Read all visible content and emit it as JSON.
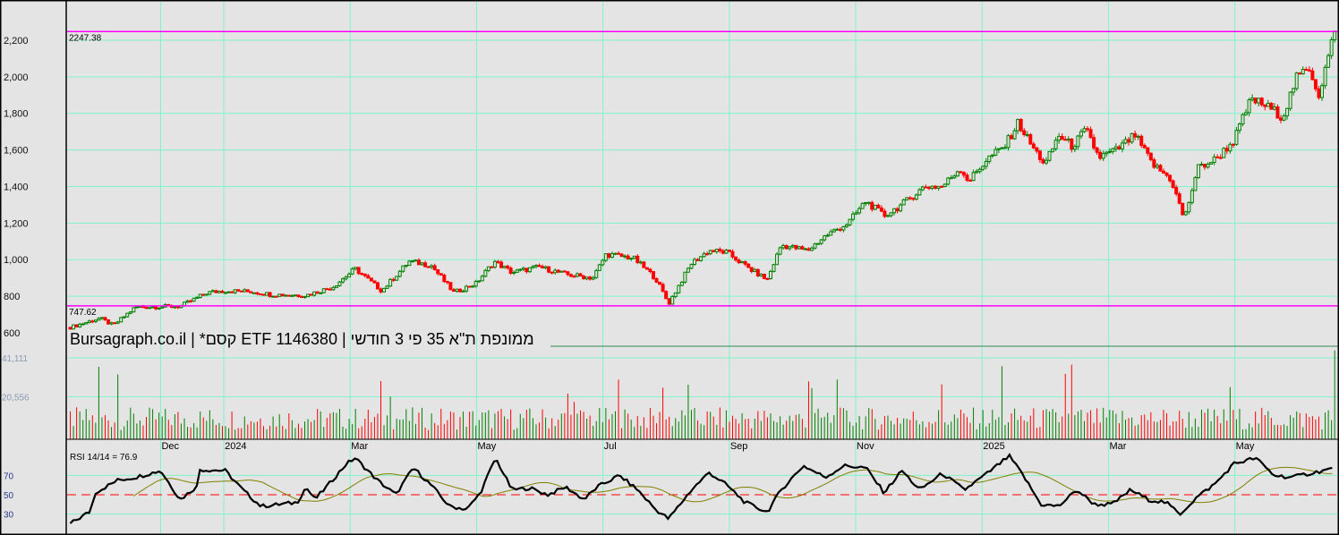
{
  "chart_data": {
    "type": "candlestick",
    "title": "Bursagraph.co.il | *קסם ETF 1146380 | ממונפת ת\"א 35 פי 3 חודשי",
    "x_unit": "months since 2023-10-01",
    "x_range": [
      0.52,
      20.62
    ],
    "month_ticks": [
      {
        "label": "Dec",
        "m": 2
      },
      {
        "label": "2024",
        "m": 3
      },
      {
        "label": "Mar",
        "m": 5
      },
      {
        "label": "May",
        "m": 7
      },
      {
        "label": "Jul",
        "m": 9
      },
      {
        "label": "Sep",
        "m": 11
      },
      {
        "label": "Nov",
        "m": 13
      },
      {
        "label": "2025",
        "m": 15
      },
      {
        "label": "Mar",
        "m": 17
      },
      {
        "label": "May",
        "m": 19
      }
    ],
    "price": {
      "ylim": [
        560,
        2290
      ],
      "ticks": [
        "600",
        "800",
        "1,000",
        "1,200",
        "1,400",
        "1,600",
        "1,800",
        "2,000",
        "2,200"
      ],
      "tick_values": [
        600,
        800,
        1000,
        1200,
        1400,
        1600,
        1800,
        2000,
        2200
      ],
      "high_line": {
        "value": 2247.38,
        "label": "2247.38",
        "color": "#ff00ff"
      },
      "low_line": {
        "value": 747.62,
        "label": "747.62",
        "color": "#ff00ff"
      },
      "close_anchors": [
        [
          0.57,
          630
        ],
        [
          1.04,
          680
        ],
        [
          1.25,
          640
        ],
        [
          1.6,
          740
        ],
        [
          2.31,
          745
        ],
        [
          2.74,
          820
        ],
        [
          3.02,
          830
        ],
        [
          3.45,
          825
        ],
        [
          3.73,
          810
        ],
        [
          4.3,
          805
        ],
        [
          4.72,
          850
        ],
        [
          5.08,
          950
        ],
        [
          5.5,
          830
        ],
        [
          5.93,
          990
        ],
        [
          6.28,
          970
        ],
        [
          6.64,
          820
        ],
        [
          6.99,
          870
        ],
        [
          7.28,
          990
        ],
        [
          7.56,
          930
        ],
        [
          7.99,
          960
        ],
        [
          8.41,
          920
        ],
        [
          8.84,
          900
        ],
        [
          9.05,
          1030
        ],
        [
          9.48,
          1010
        ],
        [
          9.83,
          900
        ],
        [
          10.04,
          760
        ],
        [
          10.4,
          980
        ],
        [
          10.68,
          1050
        ],
        [
          10.96,
          1040
        ],
        [
          11.32,
          950
        ],
        [
          11.6,
          890
        ],
        [
          11.82,
          1080
        ],
        [
          12.24,
          1050
        ],
        [
          12.52,
          1130
        ],
        [
          12.88,
          1200
        ],
        [
          13.16,
          1320
        ],
        [
          13.45,
          1240
        ],
        [
          13.73,
          1300
        ],
        [
          14.09,
          1400
        ],
        [
          14.37,
          1400
        ],
        [
          14.65,
          1500
        ],
        [
          14.79,
          1430
        ],
        [
          15.08,
          1550
        ],
        [
          15.36,
          1620
        ],
        [
          15.57,
          1750
        ],
        [
          15.79,
          1620
        ],
        [
          16.0,
          1520
        ],
        [
          16.21,
          1680
        ],
        [
          16.43,
          1620
        ],
        [
          16.64,
          1710
        ],
        [
          16.85,
          1560
        ],
        [
          17.13,
          1600
        ],
        [
          17.42,
          1680
        ],
        [
          17.7,
          1520
        ],
        [
          17.99,
          1440
        ],
        [
          18.2,
          1220
        ],
        [
          18.41,
          1500
        ],
        [
          18.7,
          1550
        ],
        [
          18.98,
          1650
        ],
        [
          19.26,
          1880
        ],
        [
          19.55,
          1830
        ],
        [
          19.76,
          1780
        ],
        [
          19.97,
          1990
        ],
        [
          20.18,
          2050
        ],
        [
          20.33,
          1900
        ],
        [
          20.47,
          2100
        ],
        [
          20.58,
          2250
        ]
      ],
      "up_color": "#008000",
      "down_color": "#ff0000"
    },
    "volume": {
      "ticks": [
        "41,111",
        "20,556"
      ],
      "tick_values": [
        41111,
        20556
      ]
    },
    "rsi": {
      "label": "RSI 14/14 = 76.9",
      "ticks": [
        "70",
        "50",
        "30"
      ],
      "tick_values": [
        70,
        50,
        30
      ],
      "anchors": [
        [
          0.57,
          20
        ],
        [
          0.89,
          33
        ],
        [
          0.96,
          52
        ],
        [
          1.32,
          65
        ],
        [
          1.6,
          68
        ],
        [
          2.0,
          75
        ],
        [
          2.31,
          45
        ],
        [
          2.6,
          60
        ],
        [
          2.62,
          76
        ],
        [
          3.02,
          75
        ],
        [
          3.3,
          55
        ],
        [
          3.59,
          38
        ],
        [
          4.16,
          42
        ],
        [
          4.3,
          58
        ],
        [
          4.44,
          45
        ],
        [
          4.65,
          60
        ],
        [
          4.94,
          82
        ],
        [
          5.08,
          88
        ],
        [
          5.43,
          65
        ],
        [
          5.72,
          50
        ],
        [
          6.0,
          78
        ],
        [
          6.28,
          60
        ],
        [
          6.57,
          38
        ],
        [
          6.85,
          35
        ],
        [
          7.06,
          52
        ],
        [
          7.3,
          88
        ],
        [
          7.56,
          55
        ],
        [
          7.84,
          57
        ],
        [
          8.13,
          50
        ],
        [
          8.41,
          58
        ],
        [
          8.7,
          45
        ],
        [
          8.91,
          58
        ],
        [
          9.26,
          70
        ],
        [
          9.55,
          55
        ],
        [
          9.83,
          35
        ],
        [
          10.04,
          25
        ],
        [
          10.4,
          55
        ],
        [
          10.68,
          73
        ],
        [
          10.96,
          60
        ],
        [
          11.25,
          42
        ],
        [
          11.6,
          32
        ],
        [
          11.82,
          55
        ],
        [
          12.17,
          80
        ],
        [
          12.52,
          68
        ],
        [
          12.81,
          80
        ],
        [
          13.16,
          78
        ],
        [
          13.45,
          52
        ],
        [
          13.73,
          75
        ],
        [
          14.01,
          55
        ],
        [
          14.37,
          72
        ],
        [
          14.72,
          55
        ],
        [
          15.08,
          72
        ],
        [
          15.43,
          90
        ],
        [
          15.65,
          70
        ],
        [
          15.93,
          40
        ],
        [
          16.21,
          38
        ],
        [
          16.5,
          55
        ],
        [
          16.78,
          40
        ],
        [
          17.06,
          40
        ],
        [
          17.35,
          55
        ],
        [
          17.63,
          45
        ],
        [
          17.91,
          42
        ],
        [
          18.13,
          30
        ],
        [
          18.41,
          48
        ],
        [
          18.7,
          62
        ],
        [
          18.98,
          82
        ],
        [
          19.33,
          88
        ],
        [
          19.62,
          70
        ],
        [
          19.9,
          68
        ],
        [
          20.18,
          72
        ],
        [
          20.4,
          75
        ],
        [
          20.54,
          77
        ]
      ],
      "signal_color": "#808000",
      "mid_line_color": "#ff0000"
    },
    "grid": true,
    "grid_color": "#7ff5c8"
  }
}
